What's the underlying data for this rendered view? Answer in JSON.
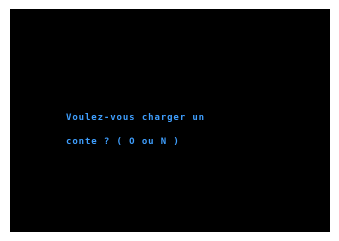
{
  "screen": {
    "background": "#000000",
    "text_color": "#3f9fff",
    "prompt_lines": [
      "Voulez-vous charger un",
      "conte ? ( O ou N )"
    ]
  }
}
